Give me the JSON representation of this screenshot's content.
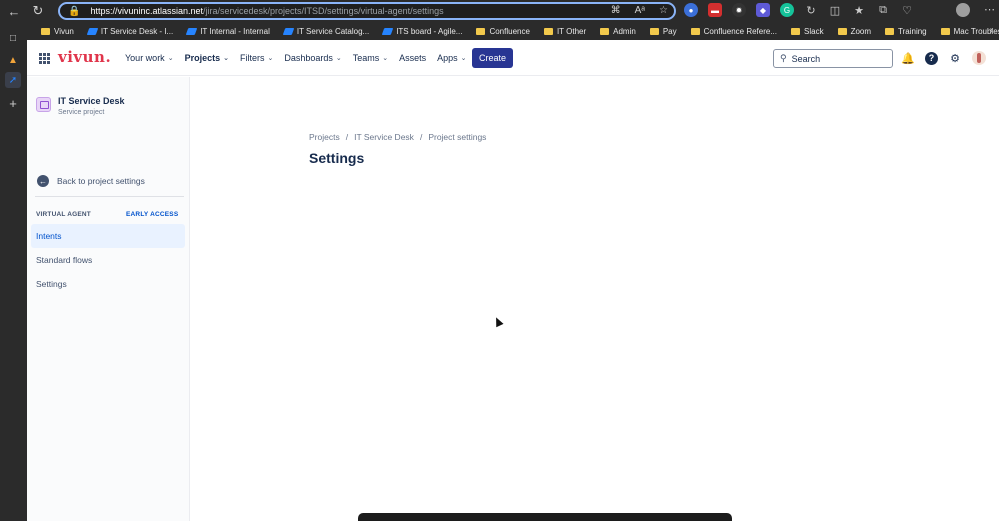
{
  "browser": {
    "url_host": "https://vivuninc.atlassian.net",
    "url_path": "/jira/servicedesk/projects/ITSD/settings/virtual-agent/settings",
    "bookmarks": [
      {
        "label": "Vivun",
        "icon": "vivun"
      },
      {
        "label": "IT Service Desk - I...",
        "icon": "jira"
      },
      {
        "label": "IT Internal - Internal",
        "icon": "jira"
      },
      {
        "label": "IT Service Catalog...",
        "icon": "jira"
      },
      {
        "label": "ITS board - Agile...",
        "icon": "jira"
      },
      {
        "label": "Confluence",
        "icon": "folder"
      },
      {
        "label": "IT Other",
        "icon": "folder"
      },
      {
        "label": "Admin",
        "icon": "folder"
      },
      {
        "label": "Pay",
        "icon": "folder"
      },
      {
        "label": "Confluence Refere...",
        "icon": "folder"
      },
      {
        "label": "Slack",
        "icon": "folder"
      },
      {
        "label": "Zoom",
        "icon": "folder"
      },
      {
        "label": "Training",
        "icon": "folder"
      },
      {
        "label": "Mac Troubleshooti...",
        "icon": "folder"
      }
    ]
  },
  "topnav": {
    "logo": "vivun.",
    "menu": [
      {
        "label": "Your work",
        "dropdown": true
      },
      {
        "label": "Projects",
        "dropdown": true,
        "active": true
      },
      {
        "label": "Filters",
        "dropdown": true
      },
      {
        "label": "Dashboards",
        "dropdown": true
      },
      {
        "label": "Teams",
        "dropdown": true
      },
      {
        "label": "Assets",
        "dropdown": false
      },
      {
        "label": "Apps",
        "dropdown": true
      }
    ],
    "create_label": "Create",
    "search_placeholder": "Search"
  },
  "sidebar": {
    "project_name": "IT Service Desk",
    "project_type": "Service project",
    "back_label": "Back to project settings",
    "section_title": "VIRTUAL AGENT",
    "section_badge": "EARLY ACCESS",
    "items": [
      {
        "label": "Intents",
        "selected": true
      },
      {
        "label": "Standard flows",
        "selected": false
      },
      {
        "label": "Settings",
        "selected": false
      }
    ]
  },
  "main": {
    "breadcrumb": [
      "Projects",
      "IT Service Desk",
      "Project settings"
    ],
    "title": "Settings"
  },
  "colors": {
    "brand": "#e0354b",
    "create_button": "#283593",
    "selected_item_bg": "#e9f2ff",
    "selected_item_text": "#0052cc",
    "focus_ring": "#8ab4f8"
  }
}
